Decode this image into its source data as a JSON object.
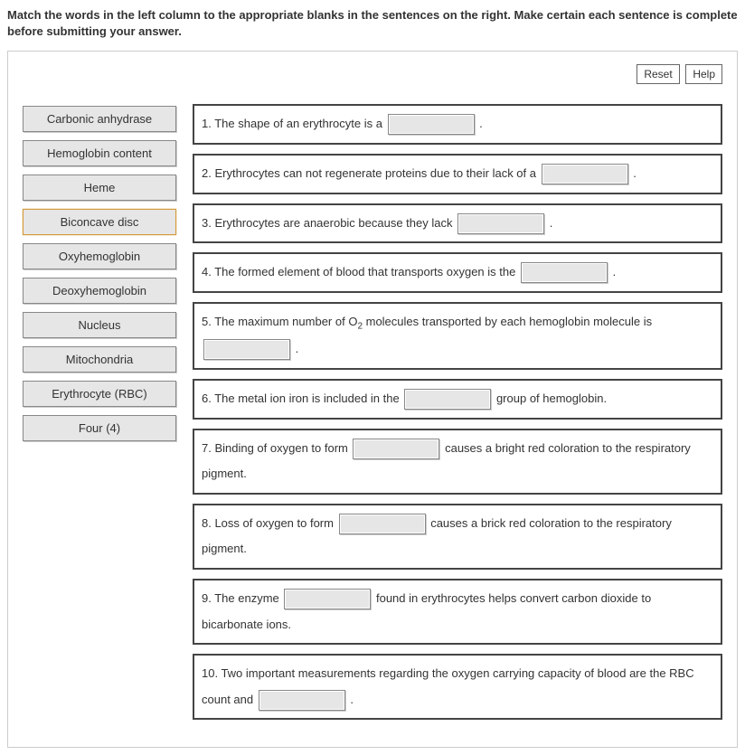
{
  "instructions": "Match the words in the left column to the appropriate blanks in the sentences on the right. Make certain each sentence is complete before submitting your answer.",
  "controls": {
    "reset_label": "Reset",
    "help_label": "Help"
  },
  "words": [
    {
      "label": "Carbonic anhydrase",
      "selected": false
    },
    {
      "label": "Hemoglobin content",
      "selected": false
    },
    {
      "label": "Heme",
      "selected": false
    },
    {
      "label": "Biconcave disc",
      "selected": true
    },
    {
      "label": "Oxyhemoglobin",
      "selected": false
    },
    {
      "label": "Deoxyhemoglobin",
      "selected": false
    },
    {
      "label": "Nucleus",
      "selected": false
    },
    {
      "label": "Mitochondria",
      "selected": false
    },
    {
      "label": "Erythrocyte (RBC)",
      "selected": false
    },
    {
      "label": "Four (4)",
      "selected": false
    }
  ],
  "sentences": {
    "s1a": "1. The shape of an erythrocyte is a ",
    "s1b": " .",
    "s2a": "2. Erythrocytes can not regenerate proteins due to their lack of a ",
    "s2b": " .",
    "s3a": "3. Erythrocytes are anaerobic because they lack ",
    "s3b": " .",
    "s4a": "4. The formed element of blood that transports oxygen is the ",
    "s4b": " .",
    "s5a": "5. The maximum number of O",
    "s5sub": "2",
    "s5b": " molecules transported by each hemoglobin molecule is ",
    "s5c": " .",
    "s6a": "6. The metal ion iron is included in the ",
    "s6b": " group of hemoglobin.",
    "s7a": "7. Binding of oxygen to form ",
    "s7b": " causes a bright red coloration to the respiratory pigment.",
    "s8a": "8. Loss of oxygen to form ",
    "s8b": " causes a brick red coloration to the respiratory pigment.",
    "s9a": "9. The enzyme ",
    "s9b": " found in erythrocytes helps convert carbon dioxide to bicarbonate ions.",
    "s10a": "10. Two important measurements regarding the oxygen carrying capacity of blood are the RBC count and ",
    "s10b": " ."
  }
}
